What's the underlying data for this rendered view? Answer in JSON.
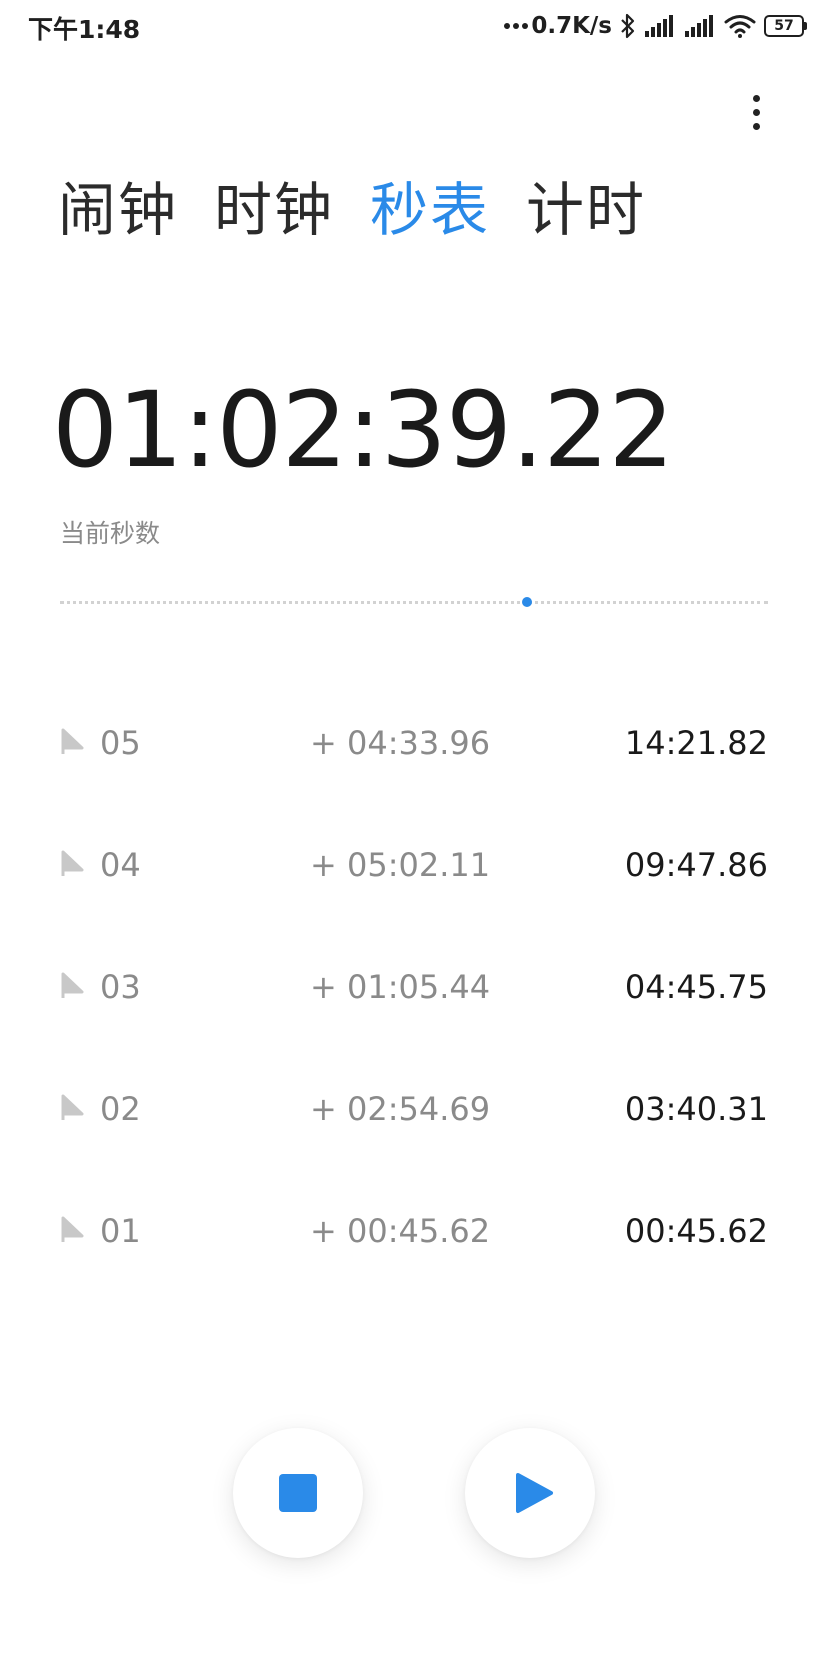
{
  "status_bar": {
    "time": "下午1:48",
    "net_speed": "0.7K/s",
    "battery": "57"
  },
  "menu": {
    "icon": "more-vertical-icon"
  },
  "tabs": [
    {
      "label": "闹钟",
      "active": false
    },
    {
      "label": "时钟",
      "active": false
    },
    {
      "label": "秒表",
      "active": true
    },
    {
      "label": "计时",
      "active": false
    }
  ],
  "stopwatch": {
    "time": "01:02:39.22",
    "label": "当前秒数",
    "progress": 0.66
  },
  "laps": [
    {
      "index": "05",
      "split": "+ 04:33.96",
      "total": "14:21.82"
    },
    {
      "index": "04",
      "split": "+ 05:02.11",
      "total": "09:47.86"
    },
    {
      "index": "03",
      "split": "+ 01:05.44",
      "total": "04:45.75"
    },
    {
      "index": "02",
      "split": "+ 02:54.69",
      "total": "03:40.31"
    },
    {
      "index": "01",
      "split": "+ 00:45.62",
      "total": "00:45.62"
    }
  ],
  "controls": {
    "stop_icon": "stop-icon",
    "play_icon": "play-icon"
  },
  "colors": {
    "accent": "#2a8ae8",
    "text": "#1a1a1a",
    "secondary": "#8a8a8a"
  }
}
